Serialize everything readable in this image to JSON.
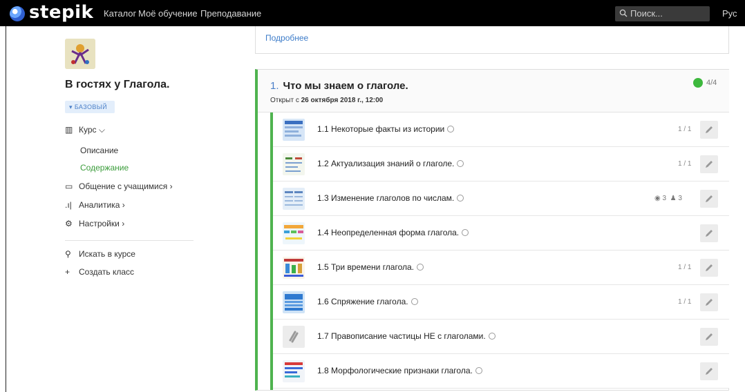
{
  "topbar": {
    "logo": "stepik",
    "nav": [
      "Каталог",
      "Моё обучение",
      "Преподавание"
    ],
    "search_placeholder": "Поиск...",
    "language": "Рус"
  },
  "sidebar": {
    "course_title": "В гостях у Глагола.",
    "level_badge": "БАЗОВЫЙ",
    "course_label": "Курс",
    "course_sub": [
      "Описание",
      "Содержание"
    ],
    "menu": [
      "Общение с учащимися",
      "Аналитика",
      "Настройки"
    ],
    "actions": [
      "Искать в курсе",
      "Создать класс"
    ]
  },
  "previous_card": {
    "more_link": "Подробнее"
  },
  "module": {
    "number": "1.",
    "title": "Что мы знаем о глаголе.",
    "open_prefix": "Открыт с",
    "open_date": "26 октября 2018 г., 12:00",
    "progress": "4/4",
    "lessons": [
      {
        "title": "1.1 Некоторые факты из истории",
        "score": "1 / 1",
        "views": "",
        "learners": ""
      },
      {
        "title": "1.2 Актуализация знаний о глаголе.",
        "score": "1 / 1",
        "views": "",
        "learners": ""
      },
      {
        "title": "1.3 Изменение глаголов по числам.",
        "score": "",
        "views": "3",
        "learners": "3"
      },
      {
        "title": "1.4 Неопределенная форма глагола.",
        "score": "",
        "views": "",
        "learners": ""
      },
      {
        "title": "1.5 Три времени глагола.",
        "score": "1 / 1",
        "views": "",
        "learners": ""
      },
      {
        "title": "1.6 Спряжение глагола.",
        "score": "1 / 1",
        "views": "",
        "learners": ""
      },
      {
        "title": "1.7 Правописание частицы НЕ с глаголами.",
        "score": "",
        "views": "",
        "learners": ""
      },
      {
        "title": "1.8 Морфологические признаки глагола.",
        "score": "",
        "views": "",
        "learners": ""
      }
    ]
  },
  "colors": {
    "accent_green": "#4fb34f",
    "link_blue": "#3d7cc9",
    "topbar": "#000000"
  }
}
